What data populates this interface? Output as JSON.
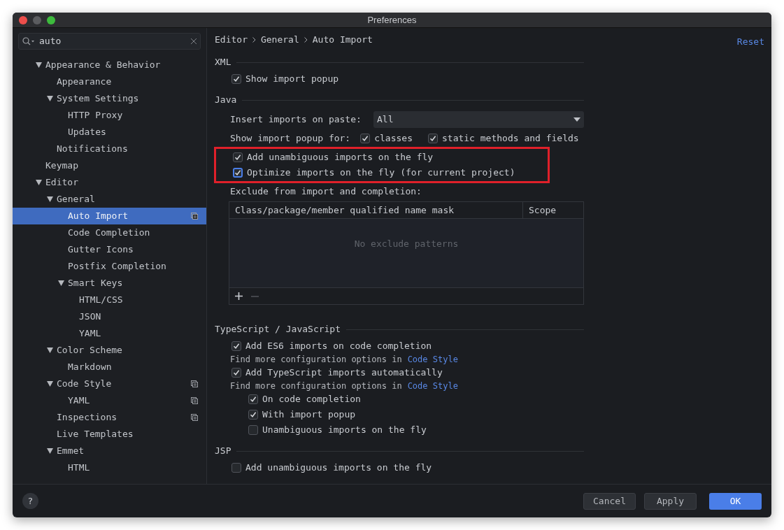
{
  "window": {
    "title": "Preferences"
  },
  "sidebar": {
    "search": {
      "value": "auto"
    },
    "items": [
      {
        "label": "Appearance & Behavior",
        "expanded": true,
        "selected": false,
        "project_level": false,
        "children": [
          {
            "label": "Appearance",
            "selected": false,
            "project_level": false
          },
          {
            "label": "System Settings",
            "expanded": true,
            "selected": false,
            "project_level": false,
            "children": [
              {
                "label": "HTTP Proxy",
                "selected": false,
                "project_level": false
              },
              {
                "label": "Updates",
                "selected": false,
                "project_level": false
              }
            ]
          },
          {
            "label": "Notifications",
            "selected": false,
            "project_level": false
          }
        ]
      },
      {
        "label": "Keymap",
        "selected": false,
        "project_level": false
      },
      {
        "label": "Editor",
        "expanded": true,
        "selected": false,
        "project_level": false,
        "children": [
          {
            "label": "General",
            "expanded": true,
            "selected": false,
            "project_level": false,
            "children": [
              {
                "label": "Auto Import",
                "selected": true,
                "project_level": true
              },
              {
                "label": "Code Completion",
                "selected": false,
                "project_level": false
              },
              {
                "label": "Gutter Icons",
                "selected": false,
                "project_level": false
              },
              {
                "label": "Postfix Completion",
                "selected": false,
                "project_level": false
              },
              {
                "label": "Smart Keys",
                "expanded": true,
                "selected": false,
                "project_level": false,
                "children": [
                  {
                    "label": "HTML/CSS",
                    "selected": false,
                    "project_level": false
                  },
                  {
                    "label": "JSON",
                    "selected": false,
                    "project_level": false
                  },
                  {
                    "label": "YAML",
                    "selected": false,
                    "project_level": false
                  }
                ]
              }
            ]
          },
          {
            "label": "Color Scheme",
            "expanded": true,
            "selected": false,
            "project_level": false,
            "children": [
              {
                "label": "Markdown",
                "selected": false,
                "project_level": false
              }
            ]
          },
          {
            "label": "Code Style",
            "expanded": true,
            "selected": false,
            "project_level": true,
            "children": [
              {
                "label": "YAML",
                "selected": false,
                "project_level": true
              }
            ]
          },
          {
            "label": "Inspections",
            "selected": false,
            "project_level": true
          },
          {
            "label": "Live Templates",
            "selected": false,
            "project_level": false
          },
          {
            "label": "Emmet",
            "expanded": true,
            "selected": false,
            "project_level": false,
            "children": [
              {
                "label": "HTML",
                "selected": false,
                "project_level": false
              }
            ]
          }
        ]
      }
    ]
  },
  "breadcrumb": [
    "Editor",
    "General",
    "Auto Import"
  ],
  "reset": "Reset",
  "sections": [
    {
      "title": "XML",
      "rows": [
        {
          "kind": "checkbox",
          "label": "Show import popup",
          "checked": true
        }
      ]
    },
    {
      "title": "Java",
      "rows": [
        {
          "kind": "select",
          "label": "Insert imports on paste:",
          "value": "All"
        },
        {
          "kind": "options",
          "label": "Show import popup for:",
          "options": [
            {
              "label": "classes",
              "checked": true
            },
            {
              "label": "static methods and fields",
              "checked": true
            }
          ]
        },
        {
          "kind": "highlight",
          "rows": [
            {
              "kind": "checkbox",
              "label": "Add unambiguous imports on the fly",
              "checked": true
            },
            {
              "kind": "checkbox",
              "label": "Optimize imports on the fly (for current project)",
              "checked": true,
              "focused": true
            }
          ]
        },
        {
          "kind": "label",
          "text": "Exclude from import and completion:"
        },
        {
          "kind": "table",
          "columns": [
            "Class/package/member qualified name mask",
            "Scope"
          ],
          "empty_text": "No exclude patterns"
        }
      ]
    },
    {
      "title": "TypeScript / JavaScript",
      "rows": [
        {
          "kind": "checkbox",
          "label": "Add ES6 imports on code completion",
          "checked": true,
          "hint": {
            "text": "Find more configuration options in",
            "link": "Code Style"
          }
        },
        {
          "kind": "checkbox",
          "label": "Add TypeScript imports automatically",
          "checked": true,
          "hint": {
            "text": "Find more configuration options in",
            "link": "Code Style"
          },
          "children": [
            {
              "kind": "checkbox",
              "label": "On code completion",
              "checked": true
            },
            {
              "kind": "checkbox",
              "label": "With import popup",
              "checked": true
            },
            {
              "kind": "checkbox",
              "label": "Unambiguous imports on the fly",
              "checked": false
            }
          ]
        }
      ]
    },
    {
      "title": "JSP",
      "rows": [
        {
          "kind": "checkbox",
          "label": "Add unambiguous imports on the fly",
          "checked": false
        }
      ]
    }
  ],
  "footer": {
    "help": "?",
    "buttons": [
      {
        "label": "Cancel",
        "primary": false
      },
      {
        "label": "Apply",
        "primary": false
      },
      {
        "label": "OK",
        "primary": true
      }
    ]
  }
}
